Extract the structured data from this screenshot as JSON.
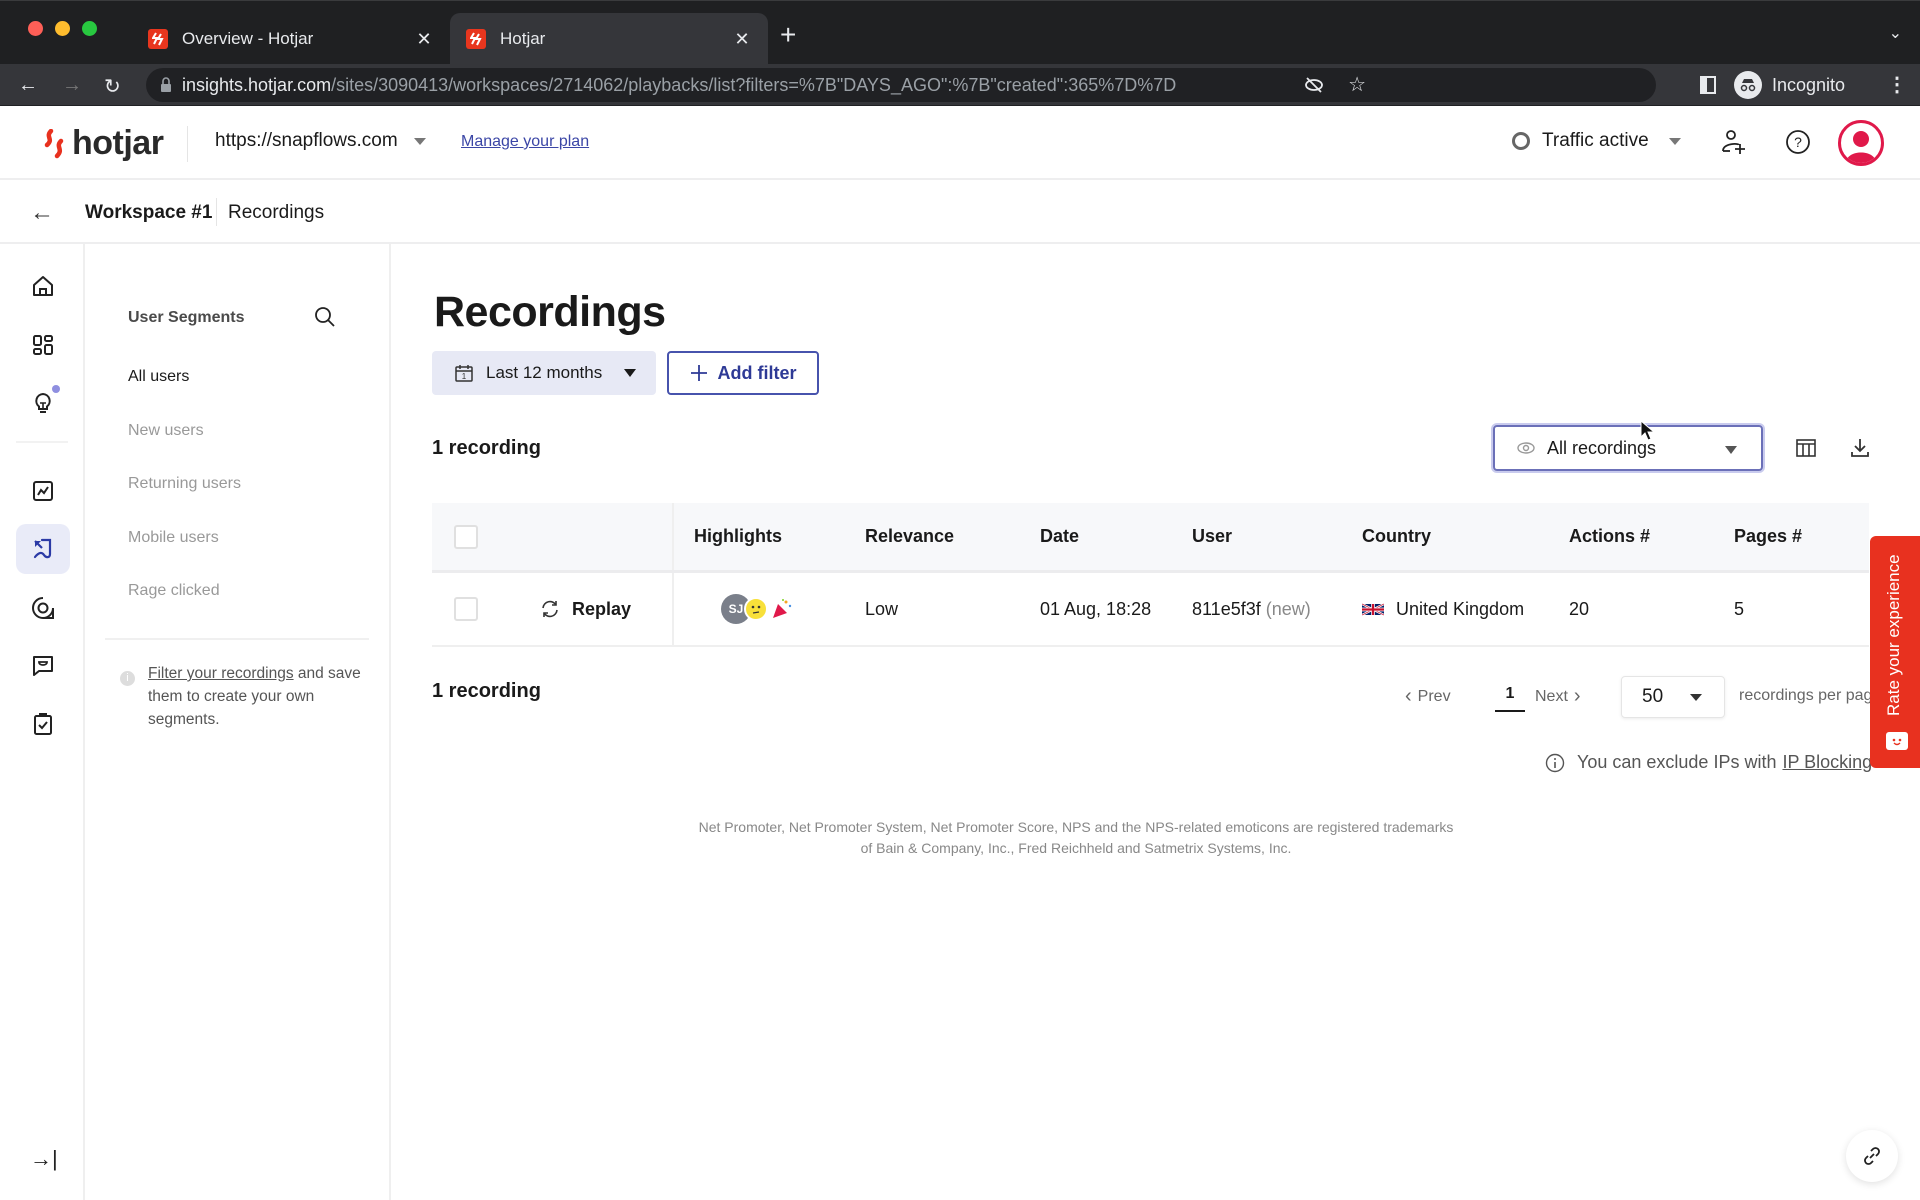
{
  "browser": {
    "tabs": [
      {
        "title": "Overview - Hotjar",
        "active": false
      },
      {
        "title": "Hotjar",
        "active": true
      }
    ],
    "url_host": "insights.hotjar.com",
    "url_path": "/sites/3090413/workspaces/2714062/playbacks/list?filters=%7B\"DAYS_AGO\":%7B\"created\":365%7D%7D",
    "profile_label": "Incognito"
  },
  "header": {
    "logo_text": "hotjar",
    "site": "https://snapflows.com",
    "manage_plan": "Manage your plan",
    "traffic_status": "Traffic active",
    "brand_color": "#e8311f",
    "avatar_color": "#e0194a"
  },
  "breadcrumb": {
    "workspace": "Workspace #1",
    "current": "Recordings"
  },
  "rail": {
    "items": [
      {
        "icon": "home-icon",
        "active": false
      },
      {
        "icon": "dashboard-icon",
        "active": false
      },
      {
        "icon": "lightbulb-icon",
        "active": false,
        "badge": true
      },
      {
        "icon": "trends-icon",
        "active": false
      },
      {
        "icon": "recordings-icon",
        "active": true
      },
      {
        "icon": "surveys-icon",
        "active": false
      },
      {
        "icon": "feedback-icon",
        "active": false
      },
      {
        "icon": "clipboard-check-icon",
        "active": false
      }
    ]
  },
  "segments": {
    "title": "User Segments",
    "items": [
      {
        "label": "All users",
        "active": true
      },
      {
        "label": "New users",
        "active": false
      },
      {
        "label": "Returning users",
        "active": false
      },
      {
        "label": "Mobile users",
        "active": false
      },
      {
        "label": "Rage clicked",
        "active": false
      }
    ],
    "info_link": "Filter your recordings",
    "info_text": " and save them to create your own segments."
  },
  "main": {
    "title": "Recordings",
    "date_filter": "Last 12 months",
    "add_filter": "Add filter",
    "count_label": "1 recording",
    "view_select": "All recordings",
    "table": {
      "columns": [
        "Highlights",
        "Relevance",
        "Date",
        "User",
        "Country",
        "Actions #",
        "Pages #"
      ],
      "rows": [
        {
          "action": "Replay",
          "highlight_initials": "SJ",
          "relevance": "Low",
          "date": "01 Aug, 18:28",
          "user": "811e5f3f",
          "user_tag": "(new)",
          "country": "United Kingdom",
          "actions": "20",
          "pages": "5"
        }
      ]
    },
    "pagination": {
      "prev": "Prev",
      "page": "1",
      "next": "Next",
      "per_page": "50",
      "per_page_label": "recordings per page"
    },
    "ip_note": "You can exclude IPs with",
    "ip_link": "IP Blocking",
    "trademark": "Net Promoter, Net Promoter System, Net Promoter Score, NPS and the NPS-related emoticons are registered trademarks of Bain & Company, Inc., Fred Reichheld and Satmetrix Systems, Inc."
  },
  "feedback_tab": "Rate your experience"
}
